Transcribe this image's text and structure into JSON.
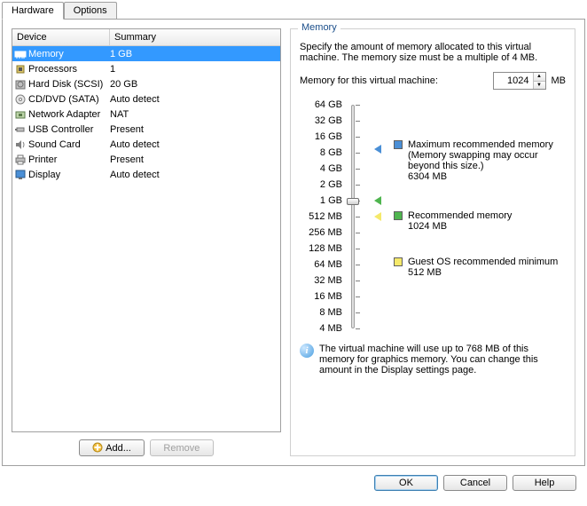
{
  "tabs": {
    "hardware": "Hardware",
    "options": "Options"
  },
  "table": {
    "headers": {
      "device": "Device",
      "summary": "Summary"
    },
    "rows": [
      {
        "device": "Memory",
        "summary": "1 GB",
        "icon": "memory",
        "selected": true
      },
      {
        "device": "Processors",
        "summary": "1",
        "icon": "cpu"
      },
      {
        "device": "Hard Disk (SCSI)",
        "summary": "20 GB",
        "icon": "hdd"
      },
      {
        "device": "CD/DVD (SATA)",
        "summary": "Auto detect",
        "icon": "cd"
      },
      {
        "device": "Network Adapter",
        "summary": "NAT",
        "icon": "net"
      },
      {
        "device": "USB Controller",
        "summary": "Present",
        "icon": "usb"
      },
      {
        "device": "Sound Card",
        "summary": "Auto detect",
        "icon": "sound"
      },
      {
        "device": "Printer",
        "summary": "Present",
        "icon": "printer"
      },
      {
        "device": "Display",
        "summary": "Auto detect",
        "icon": "display"
      }
    ]
  },
  "buttons": {
    "add": "Add...",
    "remove": "Remove",
    "ok": "OK",
    "cancel": "Cancel",
    "help": "Help"
  },
  "memory": {
    "group_title": "Memory",
    "description": "Specify the amount of memory allocated to this virtual machine. The memory size must be a multiple of 4 MB.",
    "input_label": "Memory for this virtual machine:",
    "value": "1024",
    "unit": "MB",
    "ticks": [
      "64 GB",
      "32 GB",
      "16 GB",
      "8 GB",
      "4 GB",
      "2 GB",
      "1 GB",
      "512 MB",
      "256 MB",
      "128 MB",
      "64 MB",
      "32 MB",
      "16 MB",
      "8 MB",
      "4 MB"
    ],
    "legend": {
      "max": {
        "label": "Maximum recommended memory",
        "note": "(Memory swapping may occur beyond this size.)",
        "value": "6304 MB",
        "color": "#4a8fd6"
      },
      "rec": {
        "label": "Recommended memory",
        "value": "1024 MB",
        "color": "#4fb54f"
      },
      "min": {
        "label": "Guest OS recommended minimum",
        "value": "512 MB",
        "color": "#f5e96a"
      }
    },
    "info": "The virtual machine will use up to 768 MB of this memory for graphics memory. You can change this amount in the Display settings page."
  }
}
